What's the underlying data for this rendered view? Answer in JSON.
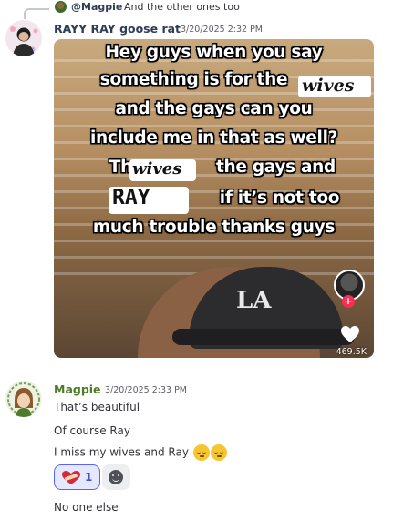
{
  "reply": {
    "author": "@Magpie",
    "text": "And the other ones too"
  },
  "message_rayy": {
    "author": "RAYY RAY goose rat",
    "author_color": "#2f3c58",
    "timestamp": "3/20/2025 2:32 PM",
    "video": {
      "caption_lines": [
        "Hey guys when you say",
        "something is for the",
        "and the gays can you",
        "include me in that as well?",
        "The",
        "the gays and",
        "if it’s not too",
        "much trouble thanks guys"
      ],
      "handwritten": [
        "wives",
        "wives",
        "RAY"
      ],
      "like_count": "469.5K",
      "icons": [
        "profile-avatar-icon",
        "follow-plus-icon",
        "heart-icon"
      ]
    }
  },
  "message_magpie": {
    "author": "Magpie",
    "author_color": "#4e7a2a",
    "timestamp": "3/20/2025 2:33 PM",
    "lines": [
      "That’s beautiful",
      "Of course Ray",
      "I miss my wives and Ray",
      "No one else"
    ],
    "reactions": [
      {
        "icon": "heart-bandage-icon",
        "count": "1"
      },
      {
        "icon": "add-reaction-icon"
      }
    ],
    "emoji": "pensive-face-icon"
  }
}
